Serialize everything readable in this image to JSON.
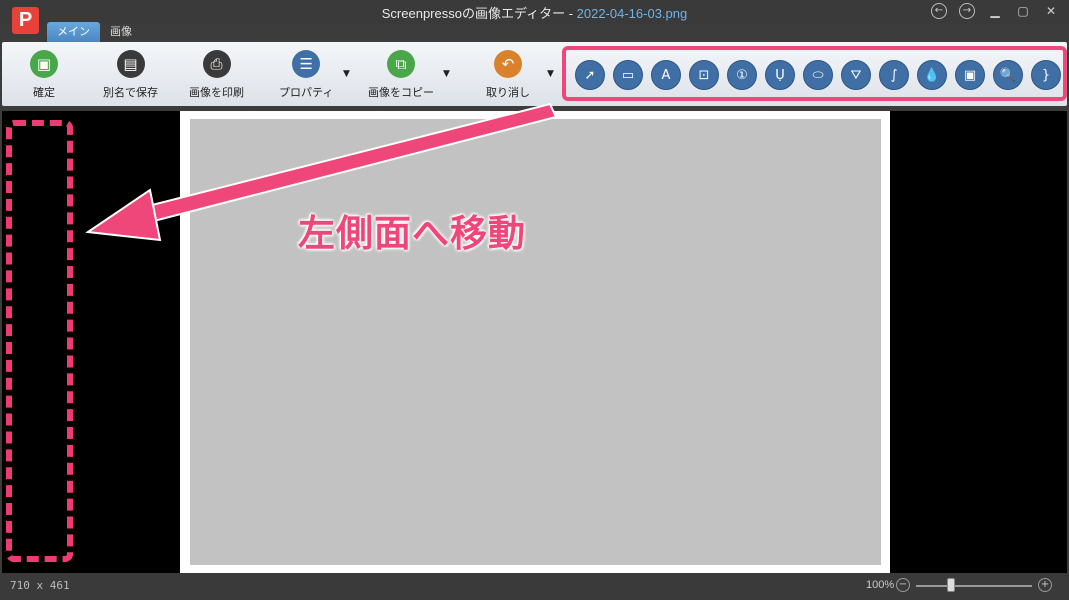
{
  "window": {
    "logo_letter": "P",
    "title": "Screenpressoの画像エディター",
    "separator": " - ",
    "filename": "2022-04-16-03.png",
    "controls": [
      "back",
      "forward",
      "minimize",
      "maximize",
      "close"
    ]
  },
  "tabs": [
    {
      "label": "メイン",
      "active": true
    },
    {
      "label": "画像",
      "active": false
    }
  ],
  "ribbon": {
    "confirm": {
      "label": "確定",
      "icon": "save-icon",
      "color": "#4aa64a"
    },
    "save_as": {
      "label": "別名で保存",
      "icon": "save-as-icon",
      "color": "#3a3a3a"
    },
    "print": {
      "label": "画像を印刷",
      "icon": "printer-icon",
      "color": "#3a3a3a"
    },
    "properties": {
      "label": "プロパティ",
      "icon": "list-icon",
      "color": "#3f6fa5"
    },
    "copy": {
      "label": "画像をコピー",
      "icon": "copy-icon",
      "color": "#4aa64a"
    },
    "undo": {
      "label": "取り消し",
      "icon": "undo-icon",
      "color": "#d9822b"
    }
  },
  "tools": [
    {
      "name": "arrow-tool-icon",
      "glyph": "➚"
    },
    {
      "name": "rectangle-tool-icon",
      "glyph": "▭"
    },
    {
      "name": "text-tool-icon",
      "glyph": "A"
    },
    {
      "name": "callout-tool-icon",
      "glyph": "⊡"
    },
    {
      "name": "numbering-tool-icon",
      "glyph": "①"
    },
    {
      "name": "magnet-tool-icon",
      "glyph": "Ụ"
    },
    {
      "name": "ellipse-tool-icon",
      "glyph": "⬭"
    },
    {
      "name": "polygon-tool-icon",
      "glyph": "⛛"
    },
    {
      "name": "freehand-tool-icon",
      "glyph": "∫"
    },
    {
      "name": "blur-tool-icon",
      "glyph": "💧"
    },
    {
      "name": "image-tool-icon",
      "glyph": "▣"
    },
    {
      "name": "magnifier-tool-icon",
      "glyph": "🔍"
    },
    {
      "name": "brace-tool-icon",
      "glyph": "}"
    }
  ],
  "annotation": {
    "text": "左側面へ移動",
    "color": "#f0477a"
  },
  "status": {
    "dimensions": "710 x 461",
    "zoom": "100%",
    "zoom_value": 100,
    "zoom_fraction": 0.3
  }
}
